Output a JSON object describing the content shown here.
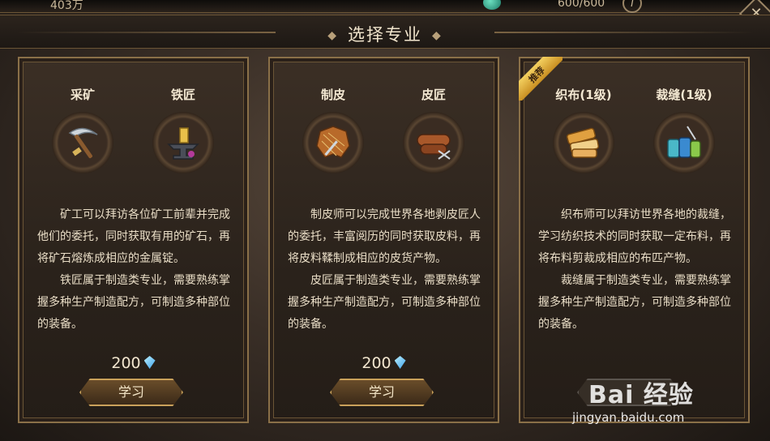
{
  "hud": {
    "currency": "403万",
    "energy": "600/600",
    "info_icon": "i"
  },
  "title": "选择专业",
  "panels": [
    {
      "ribbon": "",
      "left": {
        "name": "采矿",
        "icon": "pickaxe-icon"
      },
      "right": {
        "name": "铁匠",
        "icon": "anvil-icon"
      },
      "desc1": "矿工可以拜访各位矿工前辈并完成他们的委托，同时获取有用的矿石，再将矿石熔炼成相应的金属锭。",
      "desc2": "铁匠属于制造类专业，需要熟练掌握多种生产制造配方，可制造多种部位的装备。",
      "cost": "200",
      "button": "学习"
    },
    {
      "ribbon": "",
      "left": {
        "name": "制皮",
        "icon": "leather-hide-icon"
      },
      "right": {
        "name": "皮匠",
        "icon": "leather-roll-icon"
      },
      "desc1": "制皮师可以完成世界各地剥皮匠人的委托，丰富阅历的同时获取皮料，再将皮料鞣制成相应的皮货产物。",
      "desc2": "皮匠属于制造类专业，需要熟练掌握多种生产制造配方，可制造多种部位的装备。",
      "cost": "200",
      "button": "学习"
    },
    {
      "ribbon": "推荐",
      "left": {
        "name": "织布(1级)",
        "icon": "cloth-bolt-icon"
      },
      "right": {
        "name": "裁缝(1级)",
        "icon": "thread-spool-icon"
      },
      "desc1": "织布师可以拜访世界各地的裁缝，学习纺织技术的同时获取一定布料，再将布料剪裁成相应的布匹产物。",
      "desc2": "裁缝属于制造类专业，需要熟练掌握多种生产制造配方，可制造多种部位的装备。",
      "cost": "",
      "button": ""
    }
  ],
  "watermark": {
    "logo": "Bai 经验",
    "url": "jingyan.baidu.com"
  }
}
